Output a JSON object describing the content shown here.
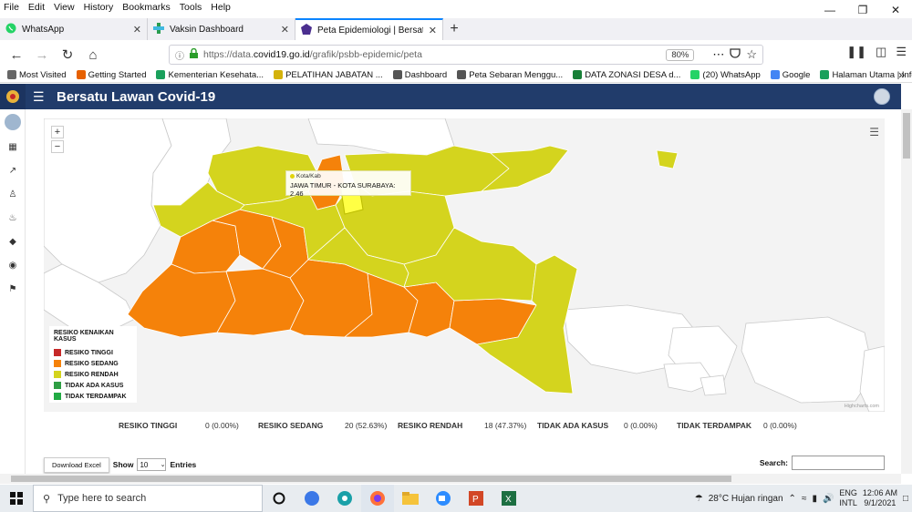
{
  "menubar": [
    "File",
    "Edit",
    "View",
    "History",
    "Bookmarks",
    "Tools",
    "Help"
  ],
  "tabs": [
    {
      "label": "WhatsApp",
      "icon": "whatsapp-icon"
    },
    {
      "label": "Vaksin Dashboard",
      "icon": "vaksin-icon"
    },
    {
      "label": "Peta Epidemiologi | Bersatu La...",
      "icon": "epidemic-icon",
      "active": true
    }
  ],
  "url": {
    "prefix": "https://data.",
    "domain": "covid19.go.id",
    "path": "/grafik/psbb-epidemic/peta",
    "zoom": "80%"
  },
  "bookmarks": [
    {
      "label": "Most Visited",
      "icon": "gear-icon",
      "color": "#666"
    },
    {
      "label": "Getting Started",
      "icon": "firefox-icon",
      "color": "#e66000"
    },
    {
      "label": "Kementerian Kesehata...",
      "icon": "kemenkes-icon",
      "color": "#1aa05c"
    },
    {
      "label": "PELATIHAN JABATAN ...",
      "icon": "pelatihan-icon",
      "color": "#d4b20b"
    },
    {
      "label": "Dashboard",
      "icon": "globe-icon",
      "color": "#555"
    },
    {
      "label": "Peta Sebaran Menggu...",
      "icon": "globe-icon",
      "color": "#555"
    },
    {
      "label": "DATA ZONASI DESA d...",
      "icon": "sheets-icon",
      "color": "#188038"
    },
    {
      "label": "(20) WhatsApp",
      "icon": "whatsapp-icon",
      "color": "#25d366"
    },
    {
      "label": "Google",
      "icon": "google-icon",
      "color": "#4285f4"
    },
    {
      "label": "Halaman Utama | Info...",
      "icon": "info-icon",
      "color": "#1aa05c"
    }
  ],
  "app": {
    "title": "Bersatu Lawan Covid-19"
  },
  "map": {
    "tooltip": {
      "category": "Kota/Kab",
      "text": "JAWA TIMUR - KOTA SURABAYA: 2.46"
    },
    "credits": "Highcharts.com",
    "legend_title": "RESIKO KENAIKAN KASUS",
    "legend": [
      {
        "label": "RESIKO TINGGI",
        "color": "#c62828"
      },
      {
        "label": "RESIKO SEDANG",
        "color": "#f5820a"
      },
      {
        "label": "RESIKO RENDAH",
        "color": "#d4d41e"
      },
      {
        "label": "TIDAK ADA KASUS",
        "color": "#2e9e44"
      },
      {
        "label": "TIDAK TERDAMPAK",
        "color": "#22aa44"
      }
    ],
    "colors": {
      "sedang": "#f5820a",
      "rendah": "#d4d41e",
      "highlight": "#ffff44",
      "empty": "#ffffff",
      "bg": "#f3f3f3"
    }
  },
  "stats": [
    {
      "label": "RESIKO TINGGI",
      "value": "0 (0.00%)"
    },
    {
      "label": "RESIKO SEDANG",
      "value": "20 (52.63%)"
    },
    {
      "label": "RESIKO RENDAH",
      "value": "18 (47.37%)"
    },
    {
      "label": "TIDAK ADA KASUS",
      "value": "0 (0.00%)"
    },
    {
      "label": "TIDAK TERDAMPAK",
      "value": "0 (0.00%)"
    }
  ],
  "table_controls": {
    "download": "Download Excel",
    "show": "Show",
    "entries_value": "10",
    "entries": "Entries",
    "search": "Search:"
  },
  "taskbar": {
    "search_placeholder": "Type here to search",
    "weather": "28°C  Hujan ringan",
    "lang1": "ENG",
    "lang2": "INTL",
    "time": "12:06 AM",
    "date": "9/1/2021"
  }
}
